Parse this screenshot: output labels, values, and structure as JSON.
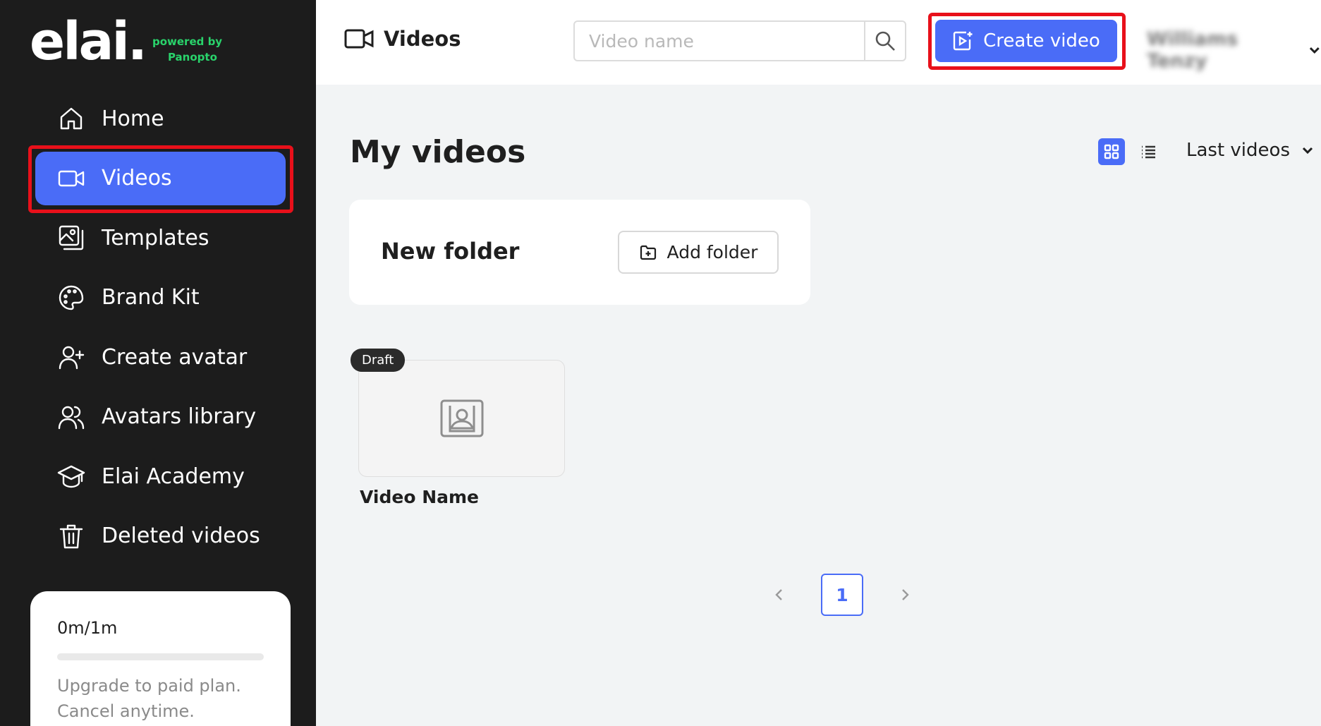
{
  "brand": {
    "logo_text": "elai.",
    "powered_by": "powered by",
    "partner": "Panopto",
    "accent_color": "#4a6cf7",
    "partner_color": "#29d36b"
  },
  "sidebar": {
    "items": [
      {
        "label": "Home",
        "icon": "home-icon"
      },
      {
        "label": "Videos",
        "icon": "video-camera-icon",
        "active": true
      },
      {
        "label": "Templates",
        "icon": "templates-icon"
      },
      {
        "label": "Brand Kit",
        "icon": "palette-icon"
      },
      {
        "label": "Create avatar",
        "icon": "add-user-icon"
      },
      {
        "label": "Avatars library",
        "icon": "users-icon"
      },
      {
        "label": "Elai Academy",
        "icon": "graduation-cap-icon"
      },
      {
        "label": "Deleted videos",
        "icon": "trash-icon"
      }
    ],
    "plan": {
      "usage": "0m/1m",
      "usage_fraction": 0,
      "message_line1": "Upgrade to paid plan.",
      "message_line2": "Cancel anytime."
    }
  },
  "header": {
    "title": "Videos",
    "search_placeholder": "Video name",
    "create_label": "Create video",
    "user_name": "Williams Tenzy"
  },
  "main": {
    "title": "My videos",
    "sort_label": "Last videos",
    "folder": {
      "title": "New folder",
      "add_label": "Add folder"
    },
    "videos": [
      {
        "status": "Draft",
        "name": "Video Name"
      }
    ],
    "pagination": {
      "current": "1"
    }
  }
}
